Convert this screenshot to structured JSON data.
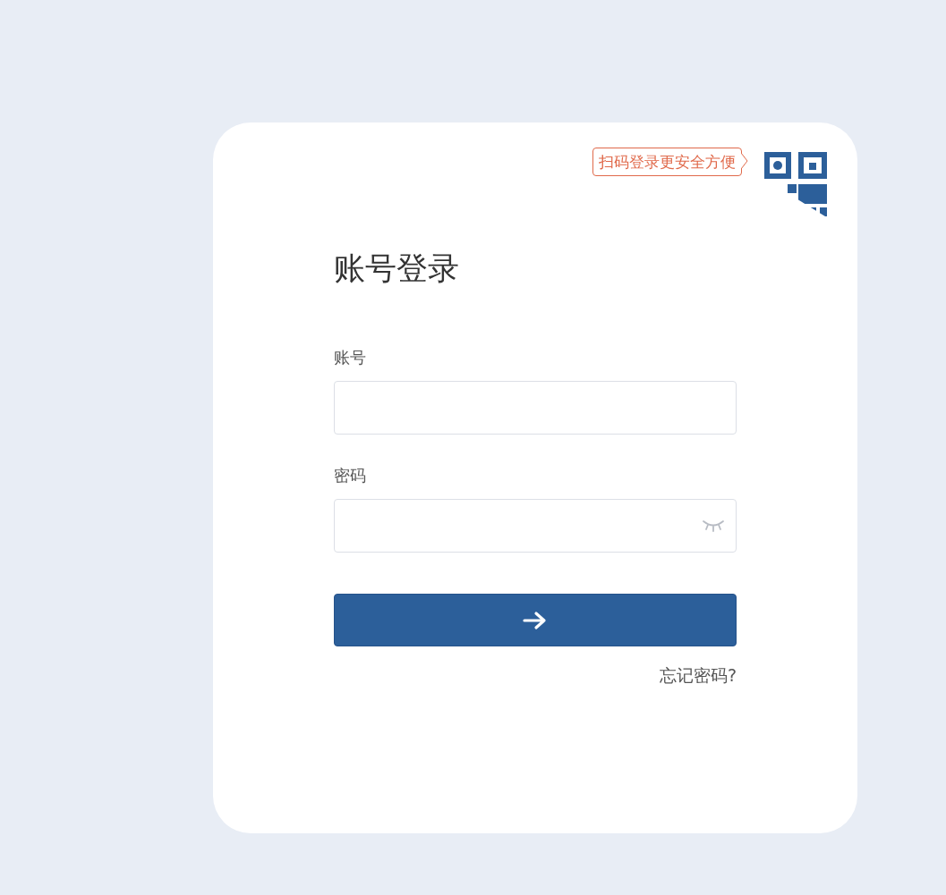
{
  "qr_hint": "扫码登录更安全方便",
  "title": "账号登录",
  "fields": [
    {
      "label": "账号",
      "kind": "text"
    },
    {
      "label": "密码",
      "kind": "password"
    }
  ],
  "forgot_link": "忘记密码?"
}
